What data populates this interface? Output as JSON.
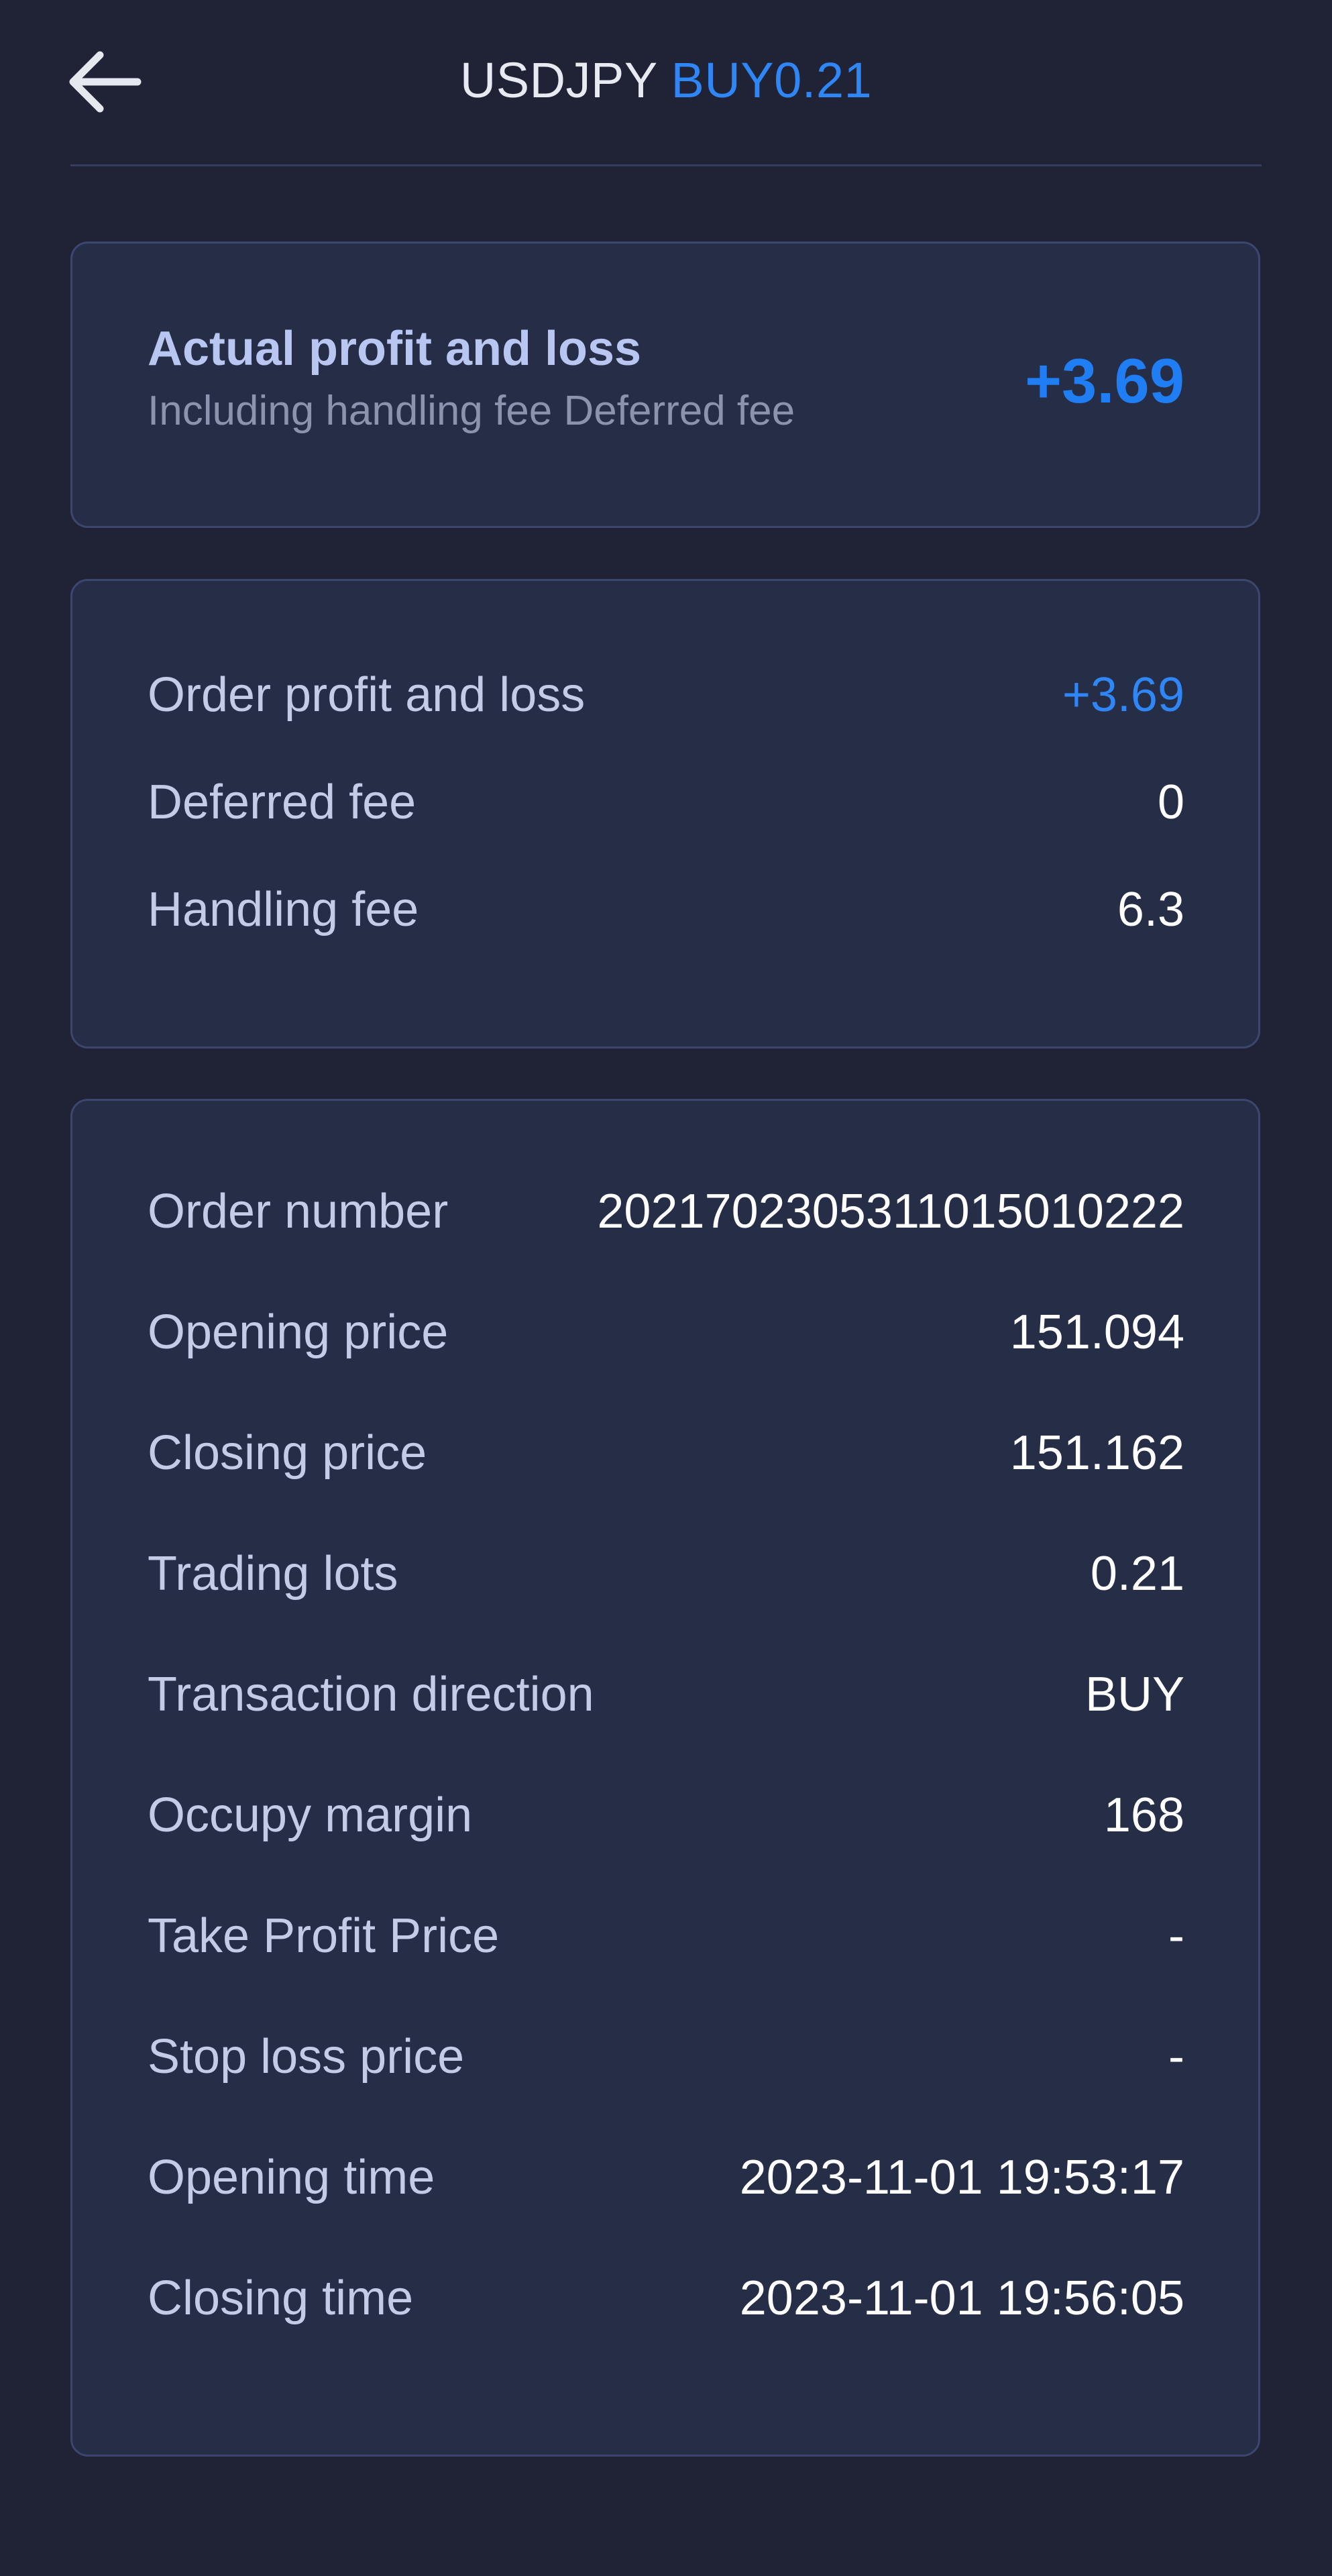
{
  "header": {
    "back_icon": "arrow-left-icon",
    "symbol": "USDJPY",
    "direction_lots": "BUY0.21",
    "accent_color": "#2f86f6"
  },
  "summary": {
    "title": "Actual profit and loss",
    "subtitle": "Including handling fee Deferred fee",
    "value": "+3.69"
  },
  "fees": {
    "items": [
      {
        "label": "Order profit and loss",
        "value": "+3.69"
      },
      {
        "label": "Deferred fee",
        "value": "0"
      },
      {
        "label": "Handling fee",
        "value": "6.3"
      }
    ]
  },
  "details": {
    "items": [
      {
        "label": "Order number",
        "value": "2021702305311015010222"
      },
      {
        "label": "Opening price",
        "value": "151.094"
      },
      {
        "label": "Closing price",
        "value": "151.162"
      },
      {
        "label": "Trading lots",
        "value": "0.21"
      },
      {
        "label": "Transaction direction",
        "value": "BUY"
      },
      {
        "label": "Occupy margin",
        "value": "168"
      },
      {
        "label": "Take Profit Price",
        "value": "-"
      },
      {
        "label": "Stop loss price",
        "value": "-"
      },
      {
        "label": "Opening time",
        "value": "2023-11-01 19:53:17"
      },
      {
        "label": "Closing time",
        "value": "2023-11-01 19:56:05"
      }
    ]
  }
}
